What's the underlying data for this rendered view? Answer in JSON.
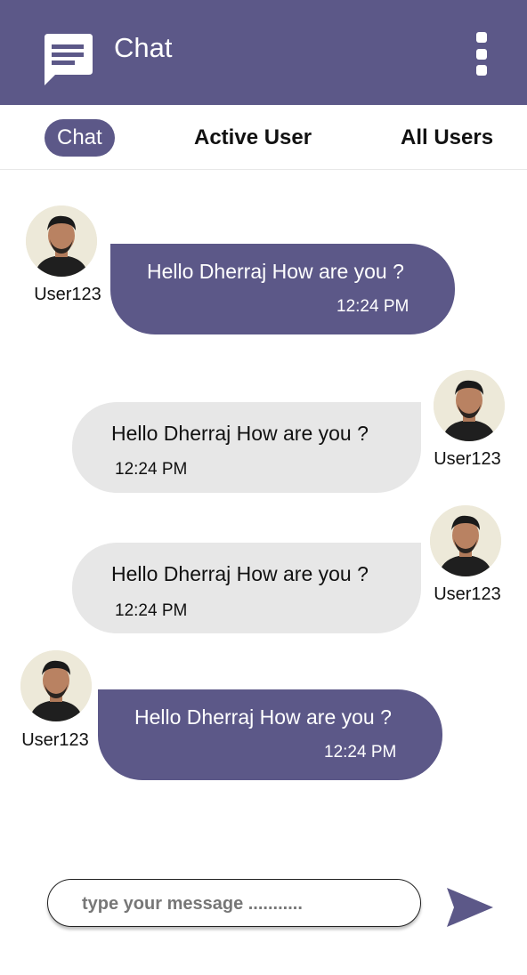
{
  "header": {
    "title": "Chat",
    "icons": {
      "app": "chat-bubble-icon",
      "menu": "kebab-menu-icon"
    }
  },
  "tabs": [
    {
      "label": "Chat",
      "active": true
    },
    {
      "label": "Active User",
      "active": false
    },
    {
      "label": "All Users",
      "active": false
    }
  ],
  "messages": [
    {
      "user": "User123",
      "text": "Hello Dherraj How are you ?",
      "time": "12:24 PM",
      "direction": "incoming"
    },
    {
      "user": "User123",
      "text": "Hello Dherraj How are you ?",
      "time": "12:24 PM",
      "direction": "outgoing"
    },
    {
      "user": "User123",
      "text": "Hello Dherraj How are you ?",
      "time": "12:24 PM",
      "direction": "outgoing"
    },
    {
      "user": "User123",
      "text": "Hello Dherraj How are you ?",
      "time": "12:24 PM",
      "direction": "incoming"
    }
  ],
  "composer": {
    "placeholder": "type your message ...........",
    "value": "",
    "send_icon": "send-icon"
  },
  "colors": {
    "primary": "#5c5888",
    "incoming_bubble": "#5c5888",
    "outgoing_bubble": "#e7e7e7"
  }
}
